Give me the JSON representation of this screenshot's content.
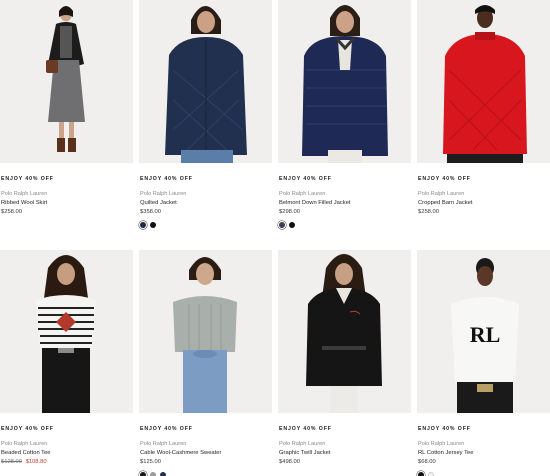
{
  "products": [
    {
      "promo": "ENJOY 40% OFF",
      "brand": "Polo Ralph Lauren",
      "name": "Ribbed Wool Skirt",
      "price": "$258.00",
      "swatches": []
    },
    {
      "promo": "ENJOY 40% OFF",
      "brand": "Polo Ralph Lauren",
      "name": "Quilted Jacket",
      "price": "$358.00",
      "swatches": [
        "#1f2b44",
        "#111111"
      ]
    },
    {
      "promo": "ENJOY 40% OFF",
      "brand": "Polo Ralph Lauren",
      "name": "Belmont Down Filled Jacket",
      "price": "$298.00",
      "swatches": [
        "#3a3f56",
        "#111111"
      ]
    },
    {
      "promo": "ENJOY 40% OFF",
      "brand": "Polo Ralph Lauren",
      "name": "Cropped Barn Jacket",
      "price": "$258.00",
      "swatches": []
    },
    {
      "promo": "ENJOY 40% OFF",
      "brand": "Polo Ralph Lauren",
      "name": "Beaded Cotton Tee",
      "price_old": "$128.00",
      "price_sale": "$108.80",
      "swatches": []
    },
    {
      "promo": "ENJOY 40% OFF",
      "brand": "Polo Ralph Lauren",
      "name": "Cable Wool-Cashmere Sweater",
      "price": "$125.00",
      "swatches": [
        "#1a1a1a",
        "#9b9b9b",
        "#23304f"
      ]
    },
    {
      "promo": "ENJOY 40% OFF",
      "brand": "Polo Ralph Lauren",
      "name": "Graphic Twill Jacket",
      "price": "$498.00",
      "swatches": []
    },
    {
      "promo": "ENJOY 40% OFF",
      "brand": "Polo Ralph Lauren",
      "name": "RL Cotton Jersey Tee",
      "price": "$68.00",
      "swatches": [
        "#111111",
        "#f3f3f3"
      ]
    }
  ]
}
